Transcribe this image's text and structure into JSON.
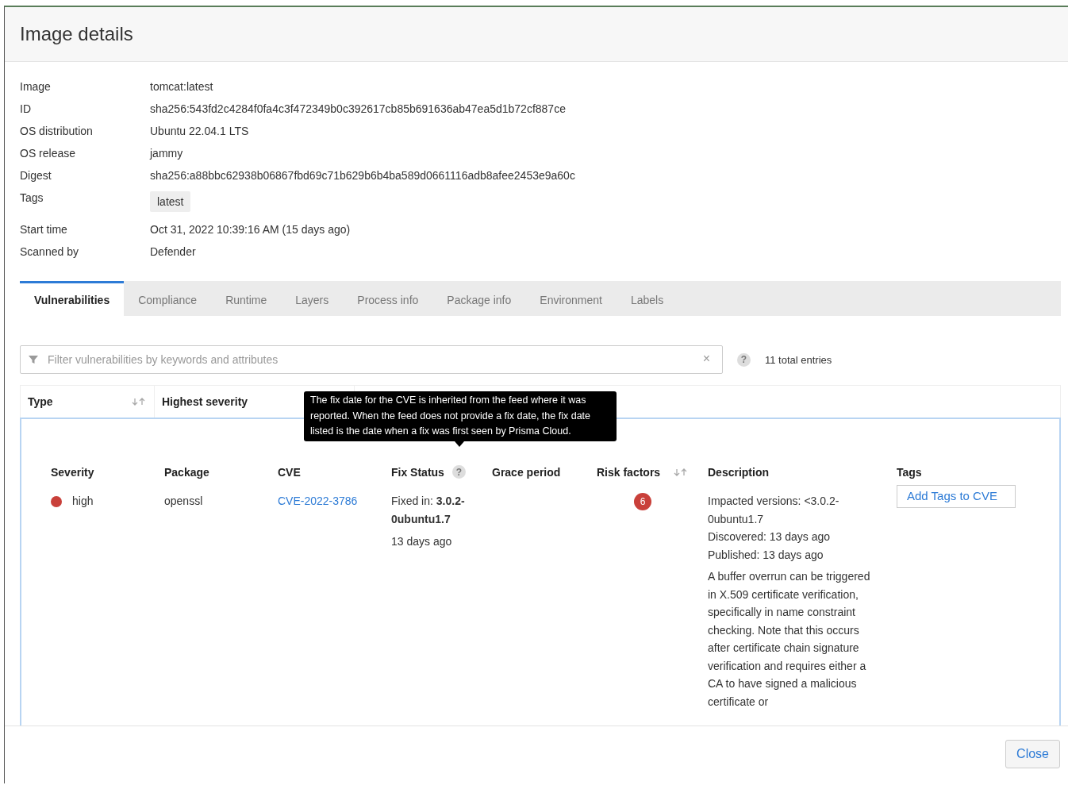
{
  "dialog": {
    "title": "Image details"
  },
  "details": [
    {
      "kind": "text",
      "label": "Image",
      "value": "tomcat:latest"
    },
    {
      "kind": "text",
      "label": "ID",
      "value": "sha256:543fd2c4284f0fa4c3f472349b0c392617cb85b691636ab47ea5d1b72cf887ce"
    },
    {
      "kind": "text",
      "label": "OS distribution",
      "value": "Ubuntu 22.04.1 LTS"
    },
    {
      "kind": "text",
      "label": "OS release",
      "value": "jammy"
    },
    {
      "kind": "text",
      "label": "Digest",
      "value": "sha256:a88bbc62938b06867fbd69c71b629b6b4ba589d0661116adb8afee2453e9a60c"
    },
    {
      "kind": "tags",
      "label": "Tags",
      "value": "latest"
    },
    {
      "kind": "text",
      "label": "Start time",
      "value": "Oct 31, 2022 10:39:16 AM (15 days ago)"
    },
    {
      "kind": "text",
      "label": "Scanned by",
      "value": "Defender"
    }
  ],
  "tabs": [
    {
      "label": "Vulnerabilities",
      "selected": true
    },
    {
      "label": "Compliance",
      "selected": false
    },
    {
      "label": "Runtime",
      "selected": false
    },
    {
      "label": "Layers",
      "selected": false
    },
    {
      "label": "Process info",
      "selected": false
    },
    {
      "label": "Package info",
      "selected": false
    },
    {
      "label": "Environment",
      "selected": false
    },
    {
      "label": "Labels",
      "selected": false
    }
  ],
  "filter": {
    "placeholder": "Filter vulnerabilities by keywords and attributes",
    "clear": "×",
    "help": "?"
  },
  "total_entries": "11 total entries",
  "outer_columns": [
    {
      "kind": "sortable",
      "label": "Type"
    },
    {
      "kind": "plain",
      "label": "Highest severity"
    }
  ],
  "tooltip": "The fix date for the CVE is inherited from the feed where it was reported. When the feed does not provide a fix date, the fix date listed is the date when a fix was first seen by Prisma Cloud.",
  "inner_columns": [
    {
      "kind": "plain",
      "label": "Severity"
    },
    {
      "kind": "plain",
      "label": "Package"
    },
    {
      "kind": "plain",
      "label": "CVE"
    },
    {
      "kind": "help",
      "label": "Fix Status"
    },
    {
      "kind": "plain",
      "label": "Grace period"
    },
    {
      "kind": "sortable",
      "label": "Risk factors"
    },
    {
      "kind": "plain",
      "label": "Description"
    },
    {
      "kind": "plain",
      "label": "Tags"
    }
  ],
  "vulnerability": {
    "severity": "high",
    "color": "#c9403a",
    "package": "openssl",
    "cve": "CVE-2022-3786",
    "fix": "Fixed in: **3.0.2-0ubuntu1.7**",
    "fix_age": "13 days ago",
    "risk_factors": "6",
    "impacted": "Impacted versions: <3.0.2-0ubuntu1.7",
    "discovered": "Discovered: 13 days ago",
    "published": "Published: 13 days ago",
    "description": "A buffer overrun can be triggered in X.509 certificate verification, specifically in name constraint checking. Note that this occurs after certificate chain signature verification and requires either a CA to have signed a malicious certificate or",
    "tags_button": "Add Tags to CVE"
  },
  "footer": {
    "button": "Close"
  }
}
